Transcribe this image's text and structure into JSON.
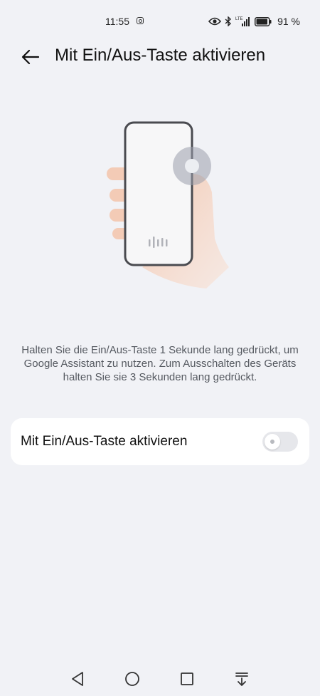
{
  "status_bar": {
    "time": "11:55",
    "battery_text": "91 %",
    "network_label": "LTE"
  },
  "header": {
    "title": "Mit Ein/Aus-Taste aktivieren"
  },
  "description": "Halten Sie die Ein/Aus-Taste 1 Sekunde lang gedrückt, um Google Assistant zu nutzen. Zum Ausschalten des Geräts halten Sie sie 3 Sekunden lang gedrückt.",
  "setting": {
    "label": "Mit Ein/Aus-Taste aktivieren",
    "enabled": false
  },
  "nav_bar": {
    "icons": [
      "back-triangle-icon",
      "home-circle-icon",
      "recents-square-icon",
      "notification-pull-icon"
    ]
  },
  "colors": {
    "background": "#f1f2f6",
    "card": "#ffffff",
    "toggle_off": "#e6e7eb",
    "text_secondary": "#555960"
  }
}
